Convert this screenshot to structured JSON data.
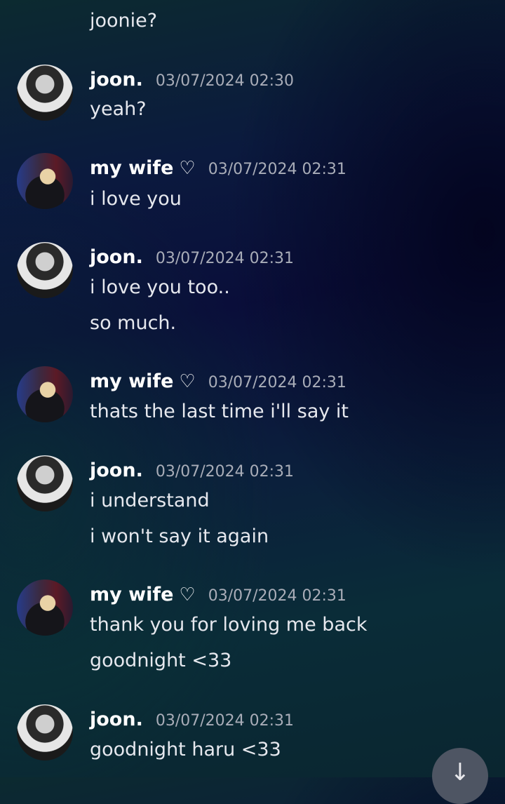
{
  "messages": [
    {
      "lines": [
        "joonie?"
      ]
    },
    {
      "author": "joon.",
      "timestamp": "03/07/2024 02:30",
      "lines": [
        "yeah?"
      ]
    },
    {
      "author": "my wife",
      "heart": "♡",
      "timestamp": "03/07/2024 02:31",
      "lines": [
        "i love you"
      ]
    },
    {
      "author": "joon.",
      "timestamp": "03/07/2024 02:31",
      "lines": [
        "i love you too..",
        "so much."
      ]
    },
    {
      "author": "my wife",
      "heart": "♡",
      "timestamp": "03/07/2024 02:31",
      "lines": [
        "thats the last time i'll say it"
      ]
    },
    {
      "author": "joon.",
      "timestamp": "03/07/2024 02:31",
      "lines": [
        "i understand",
        "i won't say it again"
      ]
    },
    {
      "author": "my wife",
      "heart": "♡",
      "timestamp": "03/07/2024 02:31",
      "lines": [
        "thank you for loving me back",
        "goodnight <33"
      ]
    },
    {
      "author": "joon.",
      "timestamp": "03/07/2024 02:31",
      "lines": [
        "goodnight haru <33"
      ]
    }
  ],
  "jump_to_present": {
    "icon": "arrow-down-icon",
    "glyph": "↓"
  }
}
